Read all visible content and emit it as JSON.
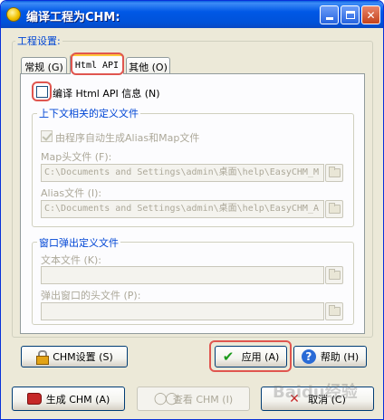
{
  "window": {
    "title": "编译工程为CHM:"
  },
  "project_settings": {
    "label": "工程设置:"
  },
  "tabs": [
    {
      "label": "常规 (G)"
    },
    {
      "label": "Html API"
    },
    {
      "label": "其他 (O)"
    }
  ],
  "html_api": {
    "compile_checkbox_label": "编译 Html API 信息 (N)",
    "context_group_label": "上下文相关的定义文件",
    "auto_generate_label": "由程序自动生成Alias和Map文件",
    "map_file_label": "Map头文件 (F):",
    "map_file_value": "C:\\Documents and Settings\\admin\\桌面\\help\\EasyCHM_M",
    "alias_file_label": "Alias文件 (I):",
    "alias_file_value": "C:\\Documents and Settings\\admin\\桌面\\help\\EasyCHM_A",
    "popup_group_label": "窗口弹出定义文件",
    "text_file_label": "文本文件 (K):",
    "text_file_value": "",
    "popup_header_label": "弹出窗口的头文件 (P):",
    "popup_header_value": ""
  },
  "buttons": {
    "chm_settings": "CHM设置 (S)",
    "apply": "应用 (A)",
    "help": "帮助 (H)",
    "generate": "生成 CHM (A)",
    "view": "查看 CHM (I)",
    "cancel": "取消 (C)"
  },
  "watermark": "Baidu经验",
  "colors": {
    "title_bar": "#0054e3",
    "group_label": "#0046d5",
    "highlight": "#e0564f"
  }
}
